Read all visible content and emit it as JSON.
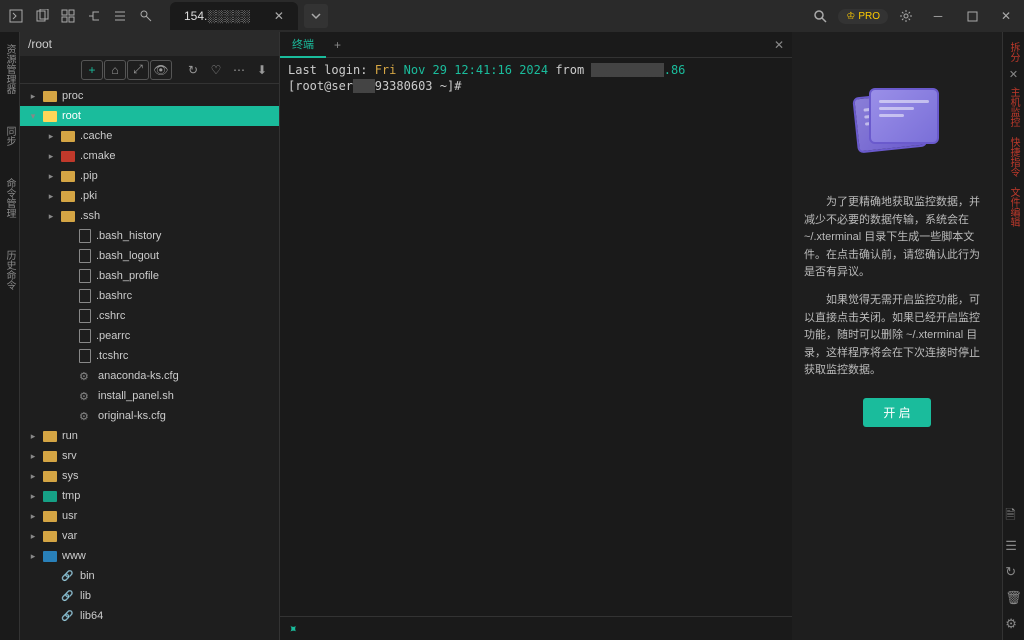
{
  "titlebar": {
    "tab_title": "154.░░░░░",
    "pro_label": "PRO"
  },
  "left_rail": {
    "items": [
      "资源管理器",
      "同步",
      "命令管理",
      "历史命令"
    ]
  },
  "file_panel": {
    "path": "/root",
    "tree": [
      {
        "depth": 0,
        "type": "folder",
        "name": "proc",
        "caret": "▸"
      },
      {
        "depth": 0,
        "type": "folder",
        "name": "root",
        "caret": "▾",
        "selected": true
      },
      {
        "depth": 1,
        "type": "folder",
        "name": ".cache",
        "caret": "▸"
      },
      {
        "depth": 1,
        "type": "folder",
        "name": ".cmake",
        "caret": "▸",
        "color": "red"
      },
      {
        "depth": 1,
        "type": "folder",
        "name": ".pip",
        "caret": "▸"
      },
      {
        "depth": 1,
        "type": "folder",
        "name": ".pki",
        "caret": "▸"
      },
      {
        "depth": 1,
        "type": "folder",
        "name": ".ssh",
        "caret": "▸"
      },
      {
        "depth": 2,
        "type": "file",
        "name": ".bash_history"
      },
      {
        "depth": 2,
        "type": "file",
        "name": ".bash_logout"
      },
      {
        "depth": 2,
        "type": "file",
        "name": ".bash_profile"
      },
      {
        "depth": 2,
        "type": "file",
        "name": ".bashrc"
      },
      {
        "depth": 2,
        "type": "file",
        "name": ".cshrc"
      },
      {
        "depth": 2,
        "type": "file",
        "name": ".pearrc"
      },
      {
        "depth": 2,
        "type": "file",
        "name": ".tcshrc"
      },
      {
        "depth": 2,
        "type": "gear",
        "name": "anaconda-ks.cfg"
      },
      {
        "depth": 2,
        "type": "gear",
        "name": "install_panel.sh"
      },
      {
        "depth": 2,
        "type": "gear",
        "name": "original-ks.cfg"
      },
      {
        "depth": 0,
        "type": "folder",
        "name": "run",
        "caret": "▸"
      },
      {
        "depth": 0,
        "type": "folder",
        "name": "srv",
        "caret": "▸"
      },
      {
        "depth": 0,
        "type": "folder",
        "name": "sys",
        "caret": "▸"
      },
      {
        "depth": 0,
        "type": "folder",
        "name": "tmp",
        "caret": "▸",
        "color": "teal"
      },
      {
        "depth": 0,
        "type": "folder",
        "name": "usr",
        "caret": "▸"
      },
      {
        "depth": 0,
        "type": "folder",
        "name": "var",
        "caret": "▸"
      },
      {
        "depth": 0,
        "type": "folder",
        "name": "www",
        "caret": "▸",
        "color": "blue"
      },
      {
        "depth": 1,
        "type": "link",
        "name": "bin"
      },
      {
        "depth": 1,
        "type": "link",
        "name": "lib"
      },
      {
        "depth": 1,
        "type": "link",
        "name": "lib64"
      }
    ]
  },
  "terminal": {
    "tab_label": "终端",
    "line1_prefix": "Last login: ",
    "line1_day": "Fri",
    "line1_date": " Nov 29 12:41:16 2024",
    "line1_from": " from ",
    "line1_ip_suffix": ".86",
    "prompt_prefix": "[root@ser",
    "prompt_host": "93380603",
    "prompt_suffix": " ~]#"
  },
  "right_panel": {
    "p1": "为了更精确地获取监控数据，并减少不必要的数据传输，系统会在 ~/.xterminal 目录下生成一些脚本文件。在点击确认前，请您确认此行为是否有异议。",
    "p2": "如果觉得无需开启监控功能，可以直接点击关闭。如果已经开启监控功能，随时可以删除 ~/.xterminal 目录，这样程序将会在下次连接时停止获取监控数据。",
    "enable_btn": "开 启"
  },
  "right_rail": {
    "items": [
      "拆分",
      "主机监控",
      "快捷指令",
      "文件编辑"
    ]
  }
}
